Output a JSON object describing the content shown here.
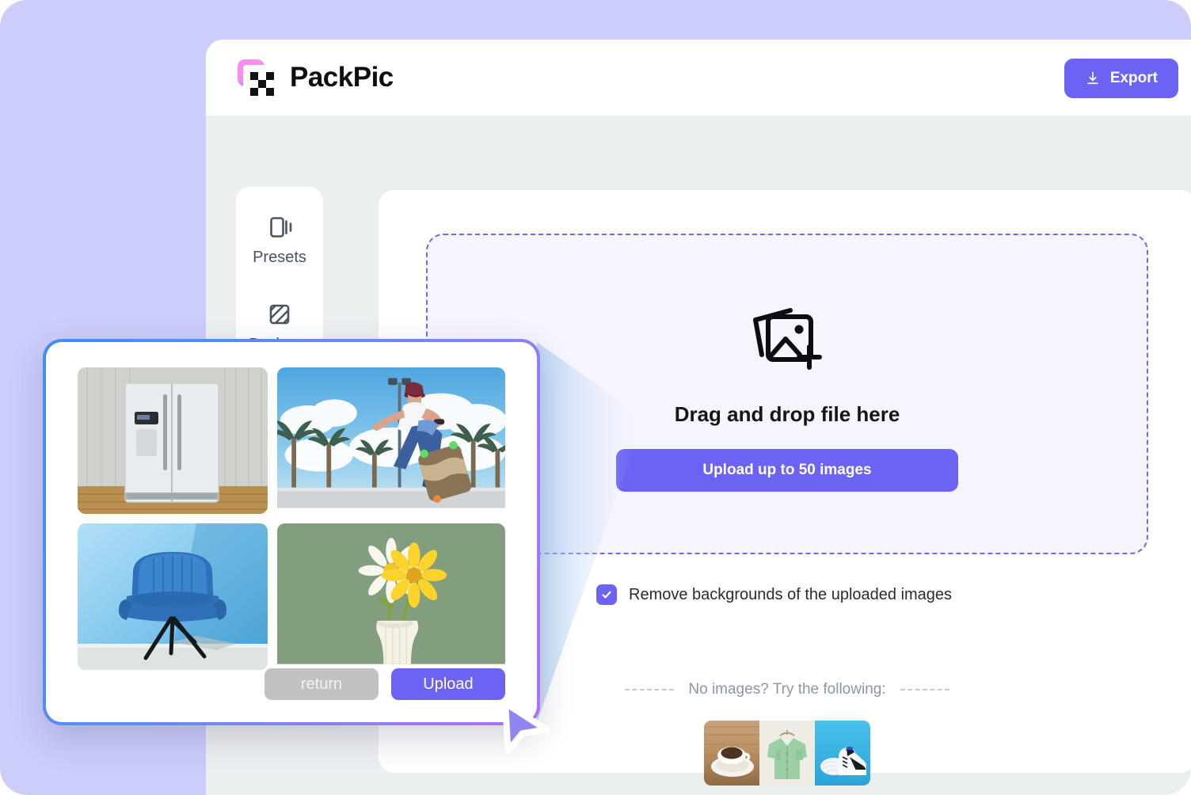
{
  "theme": {
    "page_background": "#cdcdfa",
    "workspace_background": "#eceff0",
    "accent": "#6c63f5",
    "dropzone_fill": "#f6f5fe",
    "dropzone_border": "#6f67f0",
    "dialog_border_from": "#3f8ef5",
    "dialog_border_to": "#b06ff2",
    "muted_text": "#8e96a3",
    "return_button_fill": "#c2c2c2"
  },
  "header": {
    "brand_name": "PackPic",
    "logo_icon": "packpic-logo-icon",
    "export": {
      "label": "Export",
      "icon": "download-icon"
    }
  },
  "sidebar": {
    "items": [
      {
        "label": "Presets",
        "icon": "presets-carousel-icon"
      },
      {
        "label": "Backgr...",
        "icon": "background-hatch-icon"
      }
    ]
  },
  "dropzone": {
    "icon": "add-images-icon",
    "title": "Drag and drop file here",
    "upload_button_label": "Upload up to 50 images"
  },
  "options": {
    "remove_backgrounds": {
      "label": "Remove backgrounds of the uploaded images",
      "checked": true,
      "check_icon": "check-icon"
    }
  },
  "suggestions": {
    "heading": "No images? Try the following:",
    "thumbnails": [
      {
        "name": "coffee-cup-thumbnail",
        "alt": "Cup of coffee on wooden table"
      },
      {
        "name": "green-shirt-thumbnail",
        "alt": "Green button-up shirt on hanger"
      },
      {
        "name": "sneakers-thumbnail",
        "alt": "White and black sneakers on blue background"
      }
    ]
  },
  "file_dialog": {
    "files": [
      {
        "name": "refrigerator-tile",
        "alt": "Stainless steel refrigerator against concrete wall"
      },
      {
        "name": "skateboarder-tile",
        "alt": "Skateboarder doing a trick with palm trees and clouds"
      },
      {
        "name": "blue-chair-tile",
        "alt": "Blue armchair on blue background"
      },
      {
        "name": "flower-vase-tile",
        "alt": "Daisy and yellow flower in a white vase on green background"
      }
    ],
    "return_label": "return",
    "upload_label": "Upload"
  },
  "cursor": {
    "icon": "mouse-pointer-icon"
  }
}
